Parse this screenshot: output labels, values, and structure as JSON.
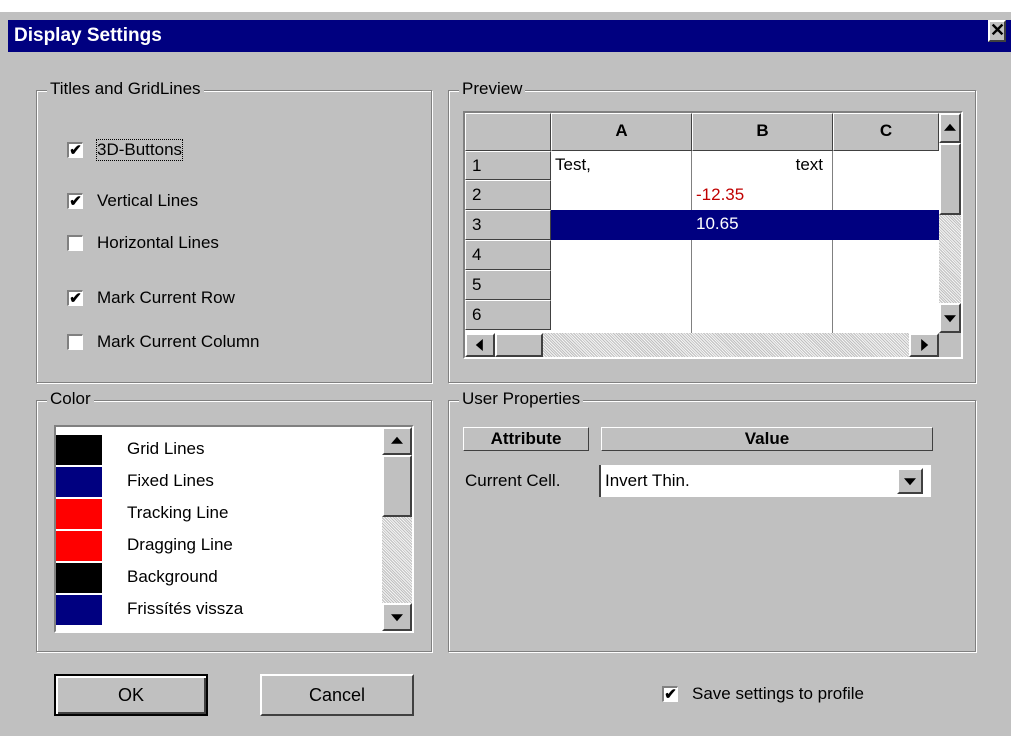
{
  "window": {
    "title": "Display Settings",
    "close_label": "✕"
  },
  "titles_group": {
    "legend": "Titles and GridLines",
    "options": [
      {
        "label": "3D-Buttons",
        "checked": true
      },
      {
        "label": "Vertical Lines",
        "checked": true
      },
      {
        "label": "Horizontal Lines",
        "checked": false
      },
      {
        "label": "Mark Current Row",
        "checked": true
      },
      {
        "label": "Mark Current Column",
        "checked": false
      }
    ]
  },
  "preview": {
    "legend": "Preview",
    "columns": [
      "A",
      "B",
      "C"
    ],
    "rows": [
      "1",
      "2",
      "3",
      "4",
      "5",
      "6"
    ],
    "cells": {
      "a1": "Test,",
      "b1": "text",
      "b2": "-12.35",
      "b3": "10.65"
    }
  },
  "color_group": {
    "legend": "Color",
    "items": [
      {
        "label": "Grid Lines",
        "color": "#000000"
      },
      {
        "label": "Fixed Lines",
        "color": "#000080"
      },
      {
        "label": "Tracking Line",
        "color": "#ff0000"
      },
      {
        "label": "Dragging Line",
        "color": "#ff0000"
      },
      {
        "label": "Background",
        "color": "#000000"
      },
      {
        "label": "Frissítés vissza",
        "color": "#000080"
      }
    ]
  },
  "user_properties": {
    "legend": "User Properties",
    "attr_header": "Attribute",
    "value_header": "Value",
    "row_label": "Current Cell.",
    "row_value": "Invert Thin."
  },
  "footer": {
    "ok_label": "OK",
    "cancel_label": "Cancel",
    "save_label": "Save settings to profile",
    "save_checked": true
  },
  "colors": {
    "highlight": "#000080",
    "negative": "#c00000"
  }
}
